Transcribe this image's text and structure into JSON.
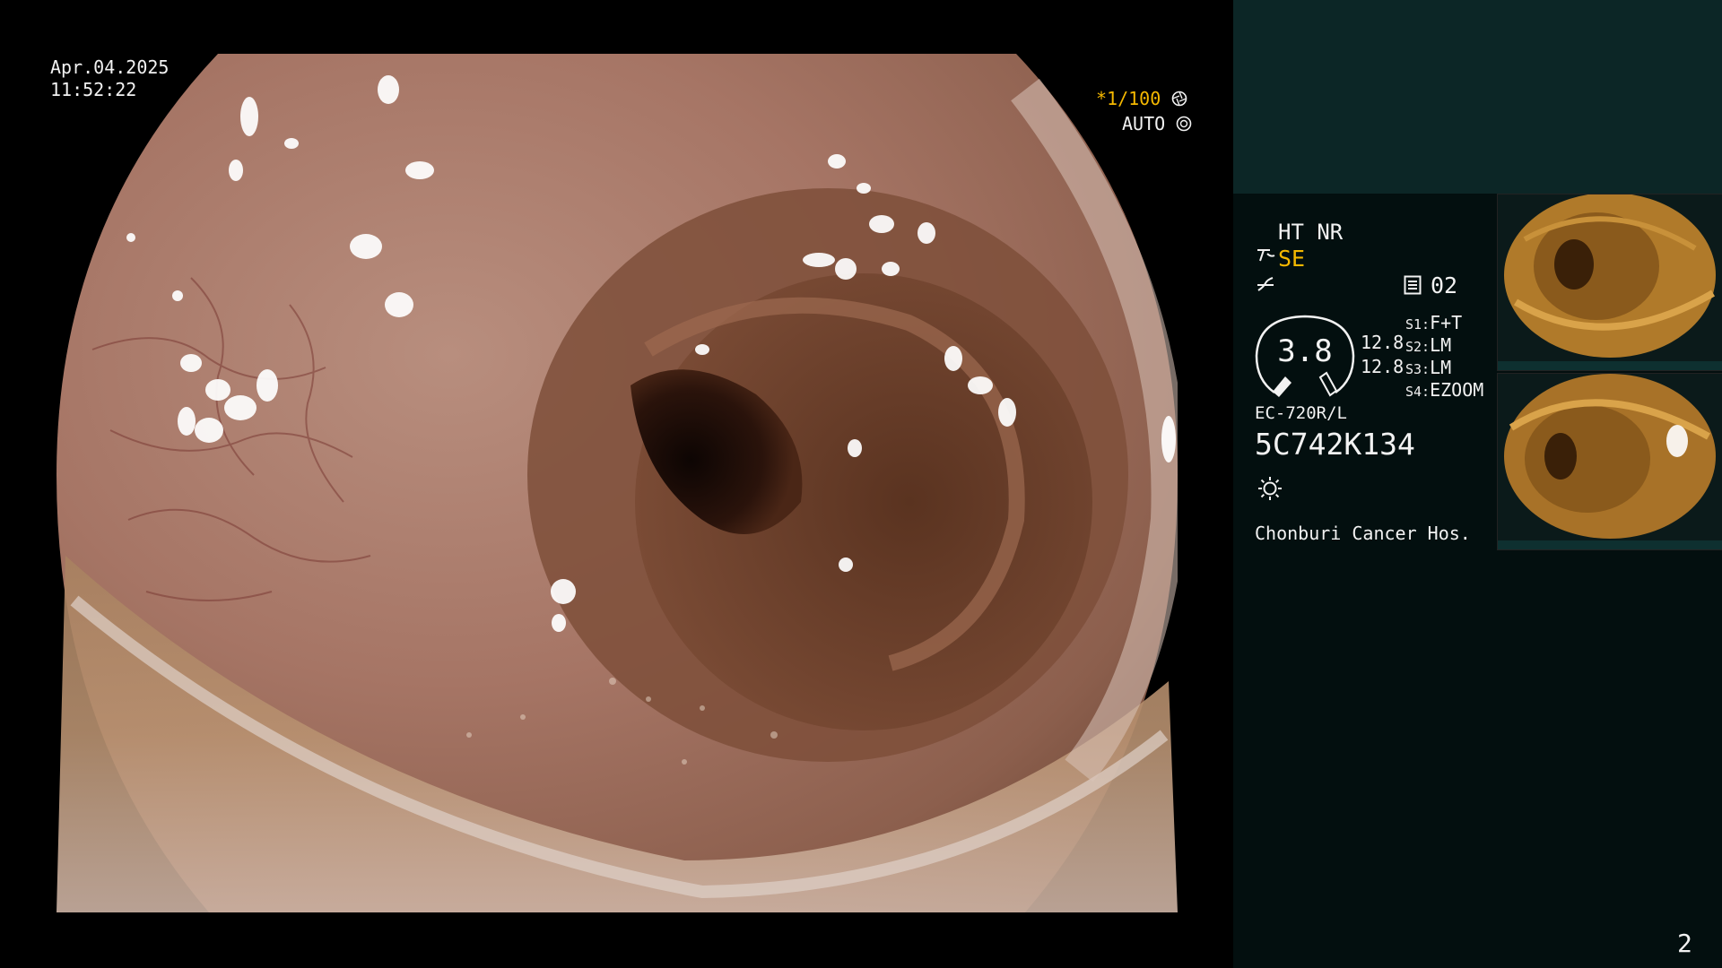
{
  "scope": {
    "date": "Apr.04.2025",
    "time": "11:52:22",
    "shutter": "*1/100",
    "shutter_icon": "aperture-icon",
    "iris": "AUTO",
    "iris_icon": "iris-icon"
  },
  "panel": {
    "mode1": "HT NR",
    "mode2": "SE",
    "memory": "02",
    "gauge_value": "3.8",
    "tone1": "12.8",
    "tone2": "12.8",
    "s1_key": "S1:",
    "s1_val": "F+T",
    "s2_key": "S2:",
    "s2_val": "LM",
    "s3_key": "S3:",
    "s3_val": "LM",
    "s4_key": "S4:",
    "s4_val": "EZOOM",
    "model": "EC-720R/L",
    "serial": "5C742K134",
    "hospital": "Chonburi Cancer Hos.",
    "page_number": "2",
    "accent_color": "#f5b800"
  }
}
